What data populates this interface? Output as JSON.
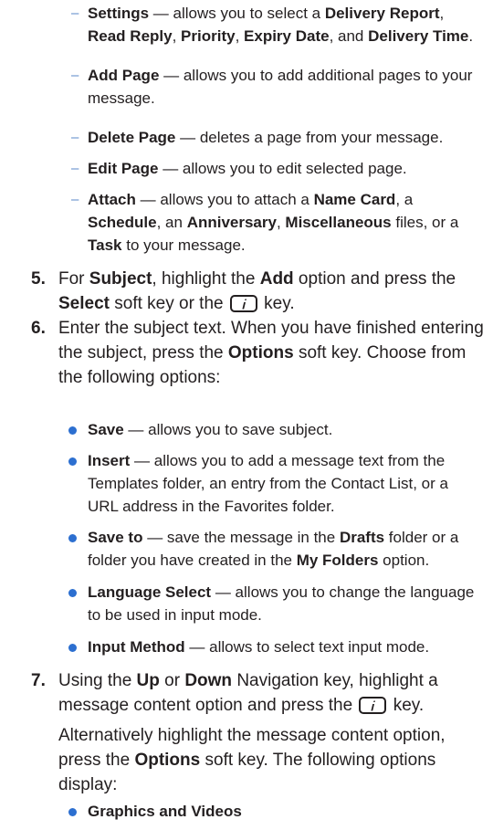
{
  "dash_items": [
    {
      "t1": "Settings",
      "t2": " — allows you to select a ",
      "t3": "Delivery Report",
      "t4": ", ",
      "t5": "Read Reply",
      "t6": ", ",
      "t7": "Priority",
      "t8": ", ",
      "t9": "Expiry Date",
      "t10": ", and ",
      "t11": "Delivery Time",
      "t12": "."
    },
    {
      "t1": "Add Page",
      "t2": " — allows you to add additional pages to your message."
    },
    {
      "t1": "Delete Page",
      "t2": " — deletes a page from your message."
    },
    {
      "t1": "Edit Page",
      "t2": " — allows you to edit selected page."
    },
    {
      "t1": "Attach",
      "t2": " — allows you to attach a ",
      "t3": "Name Card",
      "t4": ", a ",
      "t5": "Schedule",
      "t6": ", an ",
      "t7": "Anniversary",
      "t8": ", ",
      "t9": "Miscellaneous",
      "t10": " files, or a ",
      "t11": "Task",
      "t12": " to your message."
    }
  ],
  "steps": {
    "s5": {
      "num": "5.",
      "a": "For ",
      "b": "Subject",
      "c": ", highlight the ",
      "d": "Add",
      "e": " option and press the ",
      "f": "Select",
      "g": " soft key or the ",
      "h": " key."
    },
    "s6": {
      "num": "6.",
      "a": "Enter the subject text. When you have finished entering the subject, press the ",
      "b": "Options",
      "c": " soft key. Choose from the following options:"
    },
    "s7": {
      "num": "7.",
      "a": "Using the ",
      "b": "Up",
      "c": " or ",
      "d": "Down",
      "e": " Navigation key, highlight a message content option and press the ",
      "f": " key."
    }
  },
  "bullets": [
    {
      "t1": "Save",
      "t2": " — allows you to save subject."
    },
    {
      "t1": "Insert",
      "t2": " — allows you to add a message text from the Templates folder, an entry from the Contact List, or a URL address in the Favorites folder."
    },
    {
      "t1": "Save to",
      "t2": " — save the message in the ",
      "t3": "Drafts",
      "t4": " folder or a folder you have created in the ",
      "t5": "My Folders",
      "t6": " option."
    },
    {
      "t1": "Language Select",
      "t2": " — allows you to change the language to be used in input mode."
    },
    {
      "t1": "Input Method",
      "t2": " — allows to select text input mode."
    }
  ],
  "alt_para": {
    "a": "Alternatively highlight the message content option, press the ",
    "b": "Options",
    "c": " soft key. The following options display:"
  },
  "last_bullet": "Graphics and Videos",
  "icons": {
    "dash": "–",
    "key": "i-key-icon"
  },
  "colors": {
    "dash": "#5a87c8",
    "bullet": "#2c6fd0",
    "text": "#231f20"
  }
}
